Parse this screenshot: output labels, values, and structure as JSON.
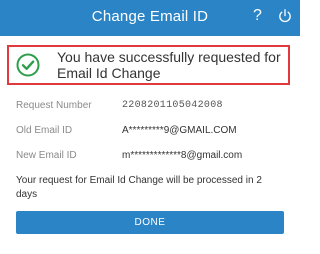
{
  "header": {
    "title": "Change Email ID",
    "help_glyph": "?"
  },
  "success": {
    "message": "You have successfully requested for Email Id Change",
    "color": "#2e9e4a",
    "border_color": "#e0393e"
  },
  "fields": [
    {
      "label": "Request Number",
      "value": "2208201105042008"
    },
    {
      "label": "Old Email ID",
      "value": "A*********9@GMAIL.COM"
    },
    {
      "label": "New Email ID",
      "value": "m*************8@gmail.com"
    }
  ],
  "note": "Your request for Email Id Change will be processed in 2 days",
  "done_label": "DONE",
  "colors": {
    "accent": "#2a84c6"
  }
}
